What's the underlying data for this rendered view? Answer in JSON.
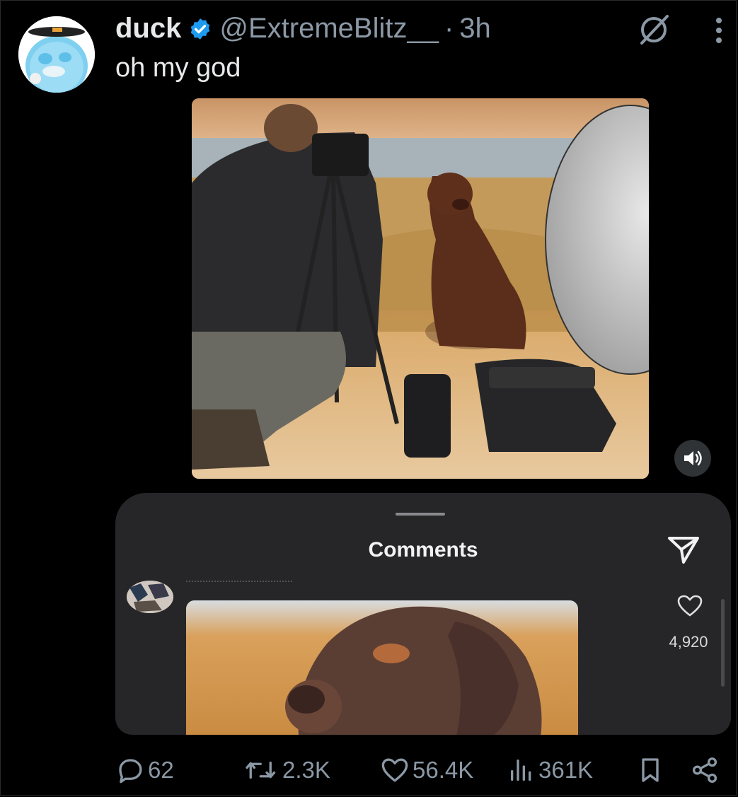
{
  "tweet": {
    "author_name": "duck",
    "handle": "@ExtremeBlitz__",
    "separator": "·",
    "time": "3h",
    "text": "oh my god",
    "icons": [
      "verified-badge-icon",
      "grok-icon",
      "more-icon"
    ]
  },
  "media": {
    "type": "video",
    "sound_icon": "volume-icon",
    "comments_sheet": {
      "title": "Comments",
      "likes": "4,920",
      "icons": [
        "send-icon",
        "heart-icon"
      ]
    }
  },
  "actions": {
    "replies": "62",
    "reposts": "2.3K",
    "likes": "56.4K",
    "views": "361K"
  },
  "colors": {
    "background": "#000000",
    "primary_text": "#e7e9ea",
    "secondary_text": "#8b98a5",
    "verified": "#1d9bf0",
    "sheet": "#262629"
  }
}
